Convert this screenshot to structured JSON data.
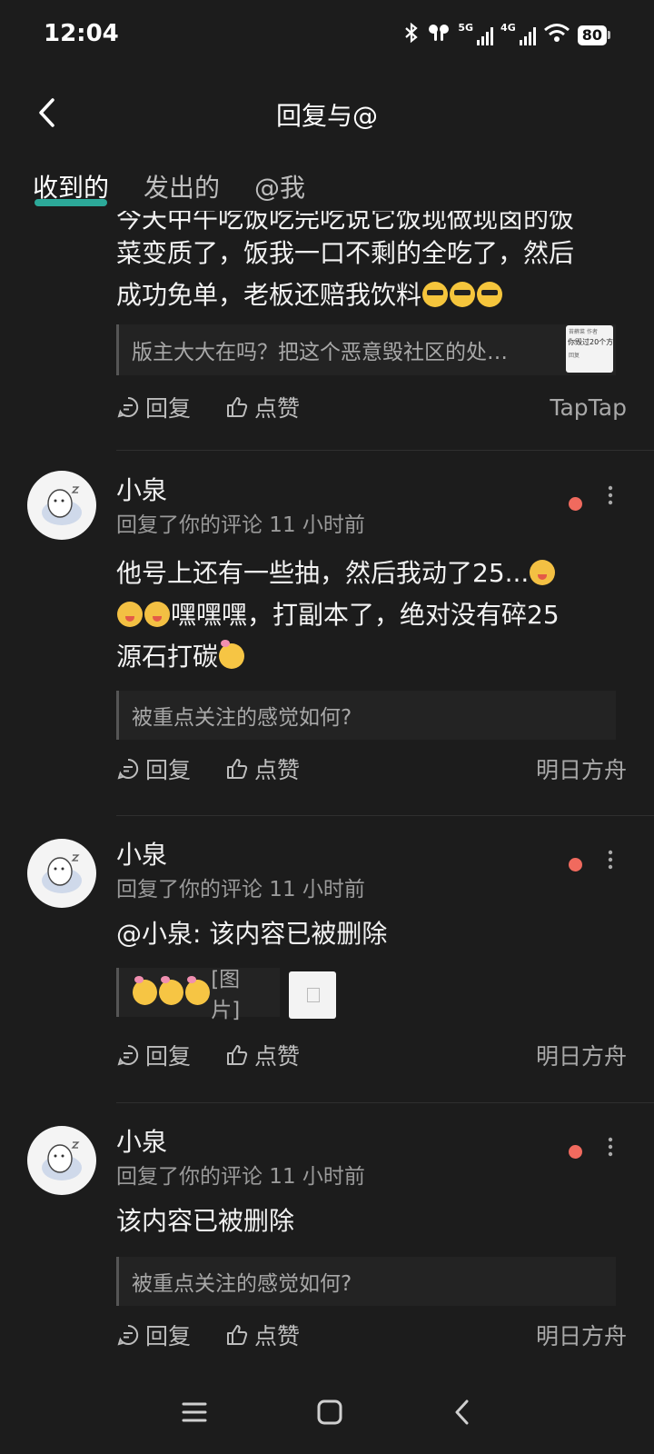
{
  "status": {
    "time": "12:04",
    "net1": "5G",
    "net2": "4G",
    "battery": "80"
  },
  "header": {
    "title": "回复与@"
  },
  "tabs": [
    {
      "label": "收到的"
    },
    {
      "label": "发出的"
    },
    {
      "label": "@我"
    }
  ],
  "partial": {
    "text_cut": "今天中午吃饭吃完吃说它饭现做现卤的饭",
    "text_line2": "菜变质了，饭我一口不剩的全吃了，然后",
    "text_line3": "成功免单，老板还赔我饮料",
    "quote": "版主大大在吗？把这个恶意毁社区的处…",
    "thumb_author": "苔蘚菜",
    "thumb_role": "作者",
    "thumb_text": "你毁过20个方",
    "thumb_reply": "回复",
    "source": "TapTap"
  },
  "actions": {
    "reply": "回复",
    "like": "点赞"
  },
  "comments": [
    {
      "name": "小泉",
      "meta": "回复了你的评论 11 小时前",
      "line1": "他号上还有一些抽，然后我动了25...",
      "line2": "嘿嘿嘿，打副本了，绝对没有碎25",
      "line3": "源石打碳",
      "quote": "被重点关注的感觉如何?",
      "source": "明日方舟"
    },
    {
      "name": "小泉",
      "meta": "回复了你的评论 11 小时前",
      "text": "@小泉: 该内容已被删除",
      "quote": "[图片]",
      "source": "明日方舟"
    },
    {
      "name": "小泉",
      "meta": "回复了你的评论 11 小时前",
      "text": "该内容已被删除",
      "quote": "被重点关注的感觉如何?",
      "source": "明日方舟"
    }
  ]
}
